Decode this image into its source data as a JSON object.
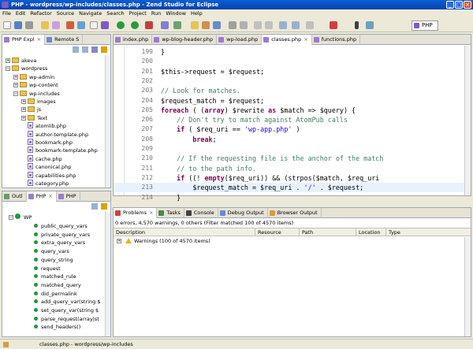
{
  "window": {
    "title": "PHP - wordpress/wp-includes/classes.php - Zend Studio for Eclipse"
  },
  "menu": [
    "File",
    "Edit",
    "Refactor",
    "Source",
    "Navigate",
    "Search",
    "Project",
    "Run",
    "Window",
    "Help"
  ],
  "toolbar": {
    "perspective_label": "PHP"
  },
  "explorer": {
    "tabs": [
      "PHP Expl",
      "Remote S"
    ],
    "items": [
      {
        "label": "akeva",
        "type": "project",
        "indent": 0,
        "expanded": false
      },
      {
        "label": "wordpress",
        "type": "project",
        "indent": 0,
        "expanded": true
      },
      {
        "label": "wp-admin",
        "type": "folder",
        "indent": 1,
        "expanded": false
      },
      {
        "label": "wp-content",
        "type": "folder",
        "indent": 1,
        "expanded": false
      },
      {
        "label": "wp-includes",
        "type": "folder",
        "indent": 1,
        "expanded": true
      },
      {
        "label": "images",
        "type": "folder",
        "indent": 2,
        "expanded": false
      },
      {
        "label": "js",
        "type": "folder",
        "indent": 2,
        "expanded": false
      },
      {
        "label": "Text",
        "type": "folder",
        "indent": 2,
        "expanded": false
      },
      {
        "label": "atomlib.php",
        "type": "file",
        "indent": 2
      },
      {
        "label": "author-template.php",
        "type": "file",
        "indent": 2
      },
      {
        "label": "bookmark.php",
        "type": "file",
        "indent": 2
      },
      {
        "label": "bookmark-template.php",
        "type": "file",
        "indent": 2
      },
      {
        "label": "cache.php",
        "type": "file",
        "indent": 2
      },
      {
        "label": "canonical.php",
        "type": "file",
        "indent": 2
      },
      {
        "label": "capabilities.php",
        "type": "file",
        "indent": 2
      },
      {
        "label": "category.php",
        "type": "file",
        "indent": 2
      }
    ]
  },
  "outline": {
    "tabs": [
      "Outl",
      "PHP",
      "PHP"
    ],
    "root": "WP",
    "items": [
      "public_query_vars",
      "private_query_vars",
      "extra_query_vars",
      "query_vars",
      "query_string",
      "request",
      "matched_rule",
      "matched_query",
      "did_permalink",
      "add_query_var(string $",
      "set_query_var(string $",
      "parse_request(array|st",
      "send_headers()"
    ]
  },
  "editor": {
    "tabs": [
      "index.php",
      "wp-blog-header.php",
      "wp-load.php",
      "classes.php",
      "functions.php"
    ],
    "active_tab": 3,
    "lines": [
      {
        "n": "199",
        "code": "            }"
      },
      {
        "n": "200",
        "code": ""
      },
      {
        "n": "201",
        "code": "            $this->request = $request;"
      },
      {
        "n": "202",
        "code": ""
      },
      {
        "n": "203",
        "code": "            // Look for matches."
      },
      {
        "n": "204",
        "code": "            $request_match = $request;"
      },
      {
        "n": "205",
        "code": "            foreach ( (array) $rewrite as $match => $query) {"
      },
      {
        "n": "206",
        "code": "                // Don't try to match against AtomPub calls"
      },
      {
        "n": "207",
        "code": "                if ( $req_uri == 'wp-app.php' )"
      },
      {
        "n": "208",
        "code": "                    break;"
      },
      {
        "n": "209",
        "code": ""
      },
      {
        "n": "210",
        "code": "                // If the requesting file is the anchor of the match"
      },
      {
        "n": "211",
        "code": "                // to the path info."
      },
      {
        "n": "212",
        "code": "                if ((! empty($req_uri)) && (strpos($match, $req_uri"
      },
      {
        "n": "213",
        "code": "                    $request_match = $req_uri . '/' . $request;"
      },
      {
        "n": "214",
        "code": "                }"
      }
    ]
  },
  "problems": {
    "tabs": [
      "Problems",
      "Tasks",
      "Console",
      "Debug Output",
      "Browser Output"
    ],
    "summary": "0 errors, 4,570 warnings, 0 others (Filter matched 100 of 4570 items)",
    "columns": [
      "Description",
      "Resource",
      "Path",
      "Location",
      "Type"
    ],
    "warnings_row": "Warnings (100 of 4570 items)"
  },
  "statusbar": {
    "text": "classes.php - wordpress/wp-includes"
  },
  "colors": {
    "title_bar": "#0842a8",
    "highlight_line": "#e8f2fe",
    "keyword": "#7f0055",
    "string": "#2a00ff",
    "comment": "#3f7f5f"
  }
}
